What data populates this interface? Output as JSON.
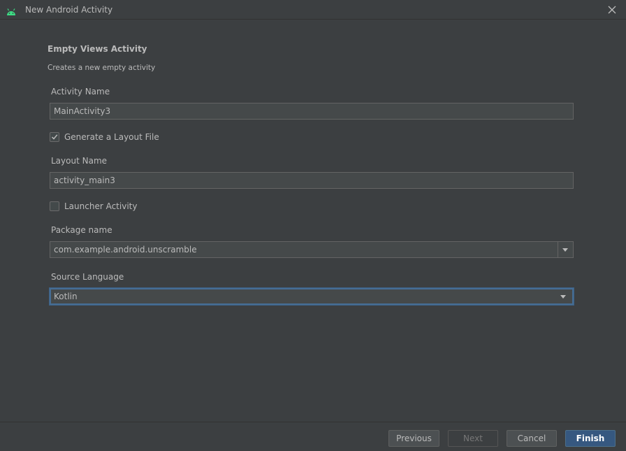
{
  "window": {
    "title": "New Android Activity",
    "icon": "android-icon",
    "close_icon": "close-icon"
  },
  "template": {
    "name": "Empty Views Activity",
    "description": "Creates a new empty activity"
  },
  "form": {
    "activity_name": {
      "label": "Activity Name",
      "value": "MainActivity3"
    },
    "generate_layout": {
      "label": "Generate a Layout File",
      "checked": true
    },
    "layout_name": {
      "label": "Layout Name",
      "value": "activity_main3"
    },
    "launcher_activity": {
      "label": "Launcher Activity",
      "checked": false
    },
    "package_name": {
      "label": "Package name",
      "value": "com.example.android.unscramble"
    },
    "source_language": {
      "label": "Source Language",
      "value": "Kotlin"
    }
  },
  "buttons": {
    "previous": "Previous",
    "next": "Next",
    "cancel": "Cancel",
    "finish": "Finish"
  },
  "colors": {
    "background": "#3c3f41",
    "accent": "#365880",
    "focus": "#466d94",
    "android_green": "#3ddc84"
  }
}
